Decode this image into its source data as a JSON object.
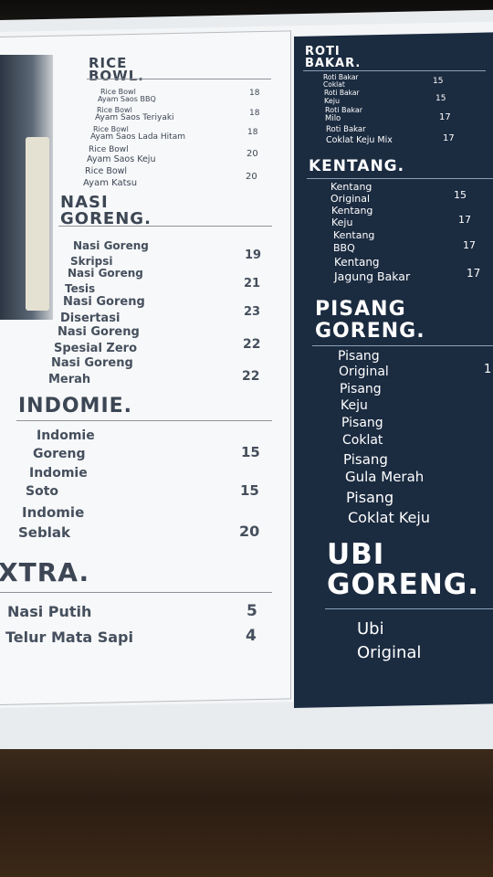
{
  "menu": {
    "rice_bowl": {
      "heading": "RICE BOWL.",
      "items": [
        {
          "name_a": "Rice Bowl",
          "name_b": "Ayam Saos BBQ",
          "price": "18"
        },
        {
          "name_a": "Rice Bowl",
          "name_b": "Ayam Saos Teriyaki",
          "price": "18"
        },
        {
          "name_a": "Rice Bowl",
          "name_b": "Ayam Saos Lada Hitam",
          "price": "18"
        },
        {
          "name_a": "Rice Bowl",
          "name_b": "Ayam Saos Keju",
          "price": "20"
        },
        {
          "name_a": "Rice Bowl",
          "name_b": "Ayam Katsu",
          "price": "20"
        }
      ]
    },
    "nasi_goreng": {
      "heading": "NASI GORENG.",
      "items": [
        {
          "name_a": "Nasi Goreng",
          "name_b": "Skripsi",
          "price": "19"
        },
        {
          "name_a": "Nasi Goreng",
          "name_b": "Tesis",
          "price": "21"
        },
        {
          "name_a": "Nasi Goreng",
          "name_b": "Disertasi",
          "price": "23"
        },
        {
          "name_a": "Nasi Goreng",
          "name_b": "Spesial Zero",
          "price": "22"
        },
        {
          "name_a": "Nasi Goreng",
          "name_b": "Merah",
          "price": "22"
        }
      ]
    },
    "indomie": {
      "heading": "INDOMIE.",
      "items": [
        {
          "name_a": "Indomie",
          "name_b": "Goreng",
          "price": "15"
        },
        {
          "name_a": "Indomie",
          "name_b": "Soto",
          "price": "15"
        },
        {
          "name_a": "Indomie",
          "name_b": "Seblak",
          "price": "20"
        }
      ]
    },
    "extra": {
      "heading": "XTRA.",
      "items": [
        {
          "name": "Nasi Putih",
          "price": "5"
        },
        {
          "name": "Telur Mata Sapi",
          "price": "4"
        }
      ]
    },
    "roti_bakar": {
      "heading": "ROTI BAKAR.",
      "items": [
        {
          "name_a": "Roti Bakar",
          "name_b": "Coklat",
          "price": "15"
        },
        {
          "name_a": "Roti Bakar",
          "name_b": "Keju",
          "price": "15"
        },
        {
          "name_a": "Roti Bakar",
          "name_b": "Milo",
          "price": "17"
        },
        {
          "name_a": "Roti Bakar",
          "name_b": "Coklat Keju Mix",
          "price": "17"
        }
      ]
    },
    "kentang": {
      "heading": "KENTANG.",
      "items": [
        {
          "name_a": "Kentang",
          "name_b": "Original",
          "price": "15"
        },
        {
          "name_a": "Kentang",
          "name_b": "Keju",
          "price": "17"
        },
        {
          "name_a": "Kentang",
          "name_b": "BBQ",
          "price": "17"
        },
        {
          "name_a": "Kentang",
          "name_b": "Jagung Bakar",
          "price": "17"
        }
      ]
    },
    "pisang_goreng": {
      "heading": "PISANG GORENG.",
      "items": [
        {
          "name_a": "Pisang",
          "name_b": "Original",
          "price": "1"
        },
        {
          "name_a": "Pisang",
          "name_b": "Keju",
          "price": ""
        },
        {
          "name_a": "Pisang",
          "name_b": "Coklat",
          "price": ""
        },
        {
          "name_a": "Pisang",
          "name_b": "Gula Merah",
          "price": ""
        },
        {
          "name_a": "Pisang",
          "name_b": "Coklat Keju",
          "price": ""
        }
      ]
    },
    "ubi_goreng": {
      "heading": "UBI GORENG.",
      "items": [
        {
          "name_a": "Ubi",
          "name_b": "Original",
          "price": ""
        }
      ]
    }
  },
  "colors": {
    "panel_dark": "#1b2b40",
    "text_dark": "#3c4654",
    "text_light": "#ffffff"
  }
}
